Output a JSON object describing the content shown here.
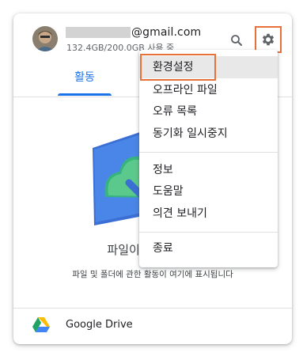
{
  "account": {
    "email_domain": "@gmail.com",
    "storage": "132.4GB/200.0GB 사용 중"
  },
  "icons": {
    "search": "search-icon",
    "settings": "gear-icon",
    "drive_logo": "google-drive-logo-icon"
  },
  "tabs": {
    "active_label": "활동"
  },
  "empty_state": {
    "title": "파일이 표시됩니다",
    "subtitle": "파일 및 폴더에 관한 활동이 여기에 표시됩니다"
  },
  "footer": {
    "label": "Google Drive"
  },
  "menu": {
    "items": [
      {
        "label": "환경설정"
      },
      {
        "label": "오프라인 파일"
      },
      {
        "label": "오류 목록"
      },
      {
        "label": "동기화 일시중지"
      },
      {
        "label": "정보"
      },
      {
        "label": "도움말"
      },
      {
        "label": "의견 보내기"
      },
      {
        "label": "종료"
      }
    ]
  },
  "colors": {
    "accent": "#1a73e8",
    "highlight_outline": "#e8703a"
  }
}
